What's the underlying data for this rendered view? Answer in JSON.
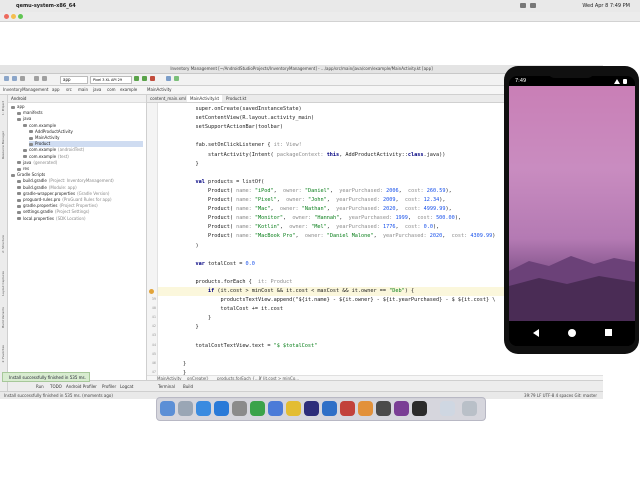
{
  "menubar": {
    "app_name": "qemu-system-x86_64",
    "clock": "Wed Apr 8 7:49 PM"
  },
  "ide": {
    "window_title": "Inventory Management [~/AndroidStudioProjects/InventoryManagement] - .../app/src/main/java/com/example/MainActivity.kt [app]",
    "nav": [
      "InventoryManagement",
      "app",
      "src",
      "main",
      "java",
      "com",
      "example",
      "MainActivity"
    ],
    "run_config": "app",
    "device": "Pixel 3 XL API 29"
  },
  "project": {
    "view_label": "Android",
    "tree": [
      {
        "label": "app",
        "indent": 0
      },
      {
        "label": "manifests",
        "indent": 1
      },
      {
        "label": "java",
        "indent": 1
      },
      {
        "label": "com.example",
        "indent": 2
      },
      {
        "label": "AddProductActivity",
        "indent": 3
      },
      {
        "label": "MainActivity",
        "indent": 3
      },
      {
        "label": "Product",
        "indent": 3,
        "selected": true
      },
      {
        "label": "com.example",
        "suffix": "(androidTest)",
        "indent": 2
      },
      {
        "label": "com.example",
        "suffix": "(test)",
        "indent": 2
      },
      {
        "label": "java",
        "suffix": "(generated)",
        "indent": 1
      },
      {
        "label": "res",
        "indent": 1
      },
      {
        "label": "Gradle Scripts",
        "indent": 0
      },
      {
        "label": "build.gradle",
        "suffix": "(Project: InventoryManagement)",
        "indent": 1
      },
      {
        "label": "build.gradle",
        "suffix": "(Module: app)",
        "indent": 1
      },
      {
        "label": "gradle-wrapper.properties",
        "suffix": "(Gradle Version)",
        "indent": 1
      },
      {
        "label": "proguard-rules.pro",
        "suffix": "(ProGuard Rules for app)",
        "indent": 1
      },
      {
        "label": "gradle.properties",
        "suffix": "(Project Properties)",
        "indent": 1
      },
      {
        "label": "settings.gradle",
        "suffix": "(Project Settings)",
        "indent": 1
      },
      {
        "label": "local.properties",
        "suffix": "(SDK Location)",
        "indent": 1
      }
    ]
  },
  "editor": {
    "tabs": [
      "content_main.xml",
      "MainActivity.kt",
      "Product.kt"
    ],
    "active_tab": 1,
    "lines": [
      {
        "n": "",
        "text": "    super.onCreate(savedInstanceState)"
      },
      {
        "n": "",
        "text": "    setContentView(R.layout.activity_main)"
      },
      {
        "n": "",
        "text": "    setSupportActionBar(toolbar)"
      },
      {
        "n": "",
        "text": ""
      },
      {
        "n": "",
        "text": "    fab.setOnClickListener { it: View!"
      },
      {
        "n": "",
        "text": "        startActivity(Intent( packageContext: this, AddProductActivity::class.java))"
      },
      {
        "n": "",
        "text": "    }"
      },
      {
        "n": "",
        "text": ""
      },
      {
        "n": "",
        "text": "    val products = listOf("
      },
      {
        "n": "",
        "text": "        Product( name: \"iPod\",  owner: \"Daniel\",  yearPurchased: 2006,  cost: 260.59),"
      },
      {
        "n": "",
        "text": "        Product( name: \"Pixel\",  owner: \"John\",  yearPurchased: 2009,  cost: 12.34),"
      },
      {
        "n": "",
        "text": "        Product( name: \"Mac\",  owner: \"Nathan\",  yearPurchased: 2020,  cost: 4999.99),"
      },
      {
        "n": "",
        "text": "        Product( name: \"Monitor\",  owner: \"Hannah\",  yearPurchased: 1999,  cost: 500.00),"
      },
      {
        "n": "",
        "text": "        Product( name: \"Kotlin\",  owner: \"Mel\",  yearPurchased: 1776,  cost: 0.0),"
      },
      {
        "n": "",
        "text": "        Product( name: \"MacBook Pro\",  owner: \"Daniel Malone\",  yearPurchased: 2020,  cost: 4309.99)"
      },
      {
        "n": "",
        "text": "    )"
      },
      {
        "n": "",
        "text": ""
      },
      {
        "n": "",
        "text": "    var totalCost = 0.0"
      },
      {
        "n": "",
        "text": ""
      },
      {
        "n": "",
        "text": "    products.forEach {  it: Product"
      },
      {
        "n": "39",
        "text": "        if (it.cost > minCost && it.cost < maxCost && it.owner == \"Deb\") {",
        "highlight": true
      },
      {
        "n": "40",
        "text": "            productsTextView.append(\"${it.name} - ${it.owner} - ${it.yearPurchased} - $ ${it.cost} \\"
      },
      {
        "n": "41",
        "text": "            totalCost += it.cost"
      },
      {
        "n": "42",
        "text": "        }"
      },
      {
        "n": "43",
        "text": "    }"
      },
      {
        "n": "44",
        "text": ""
      },
      {
        "n": "45",
        "text": "    totalCostTextView.text = \"$ $totalCost\""
      },
      {
        "n": "46",
        "text": ""
      },
      {
        "n": "47",
        "text": "}"
      },
      {
        "n": "48",
        "text": "}"
      }
    ],
    "breadcrumb": [
      "MainActivity",
      "onCreate()",
      "products.forEach {...}",
      "if (it.cost > minCo..."
    ]
  },
  "bottom_tabs": [
    "Run",
    "TODO",
    "Android Profiler",
    "Logcat",
    "Profiler",
    "Terminal",
    "Build"
  ],
  "toast": "Install successfully finished in 535 ms.",
  "statusbar": {
    "left": "Install successfully finished in 535 ms. (moments ago)",
    "right": "39:79  LF  UTF-8  4 spaces  Git: master"
  },
  "left_vertical_tabs": [
    "1: Project",
    "Resource Manager",
    "2: Structure",
    "Layout Captures",
    "Build Variants",
    "2: Favorites"
  ],
  "phone": {
    "time": "7:49"
  },
  "colors": {
    "keyword": "#000080",
    "string": "#067d17",
    "number": "#1750eb",
    "param_hint": "#8c8c8c",
    "accent": "#3574f0"
  }
}
